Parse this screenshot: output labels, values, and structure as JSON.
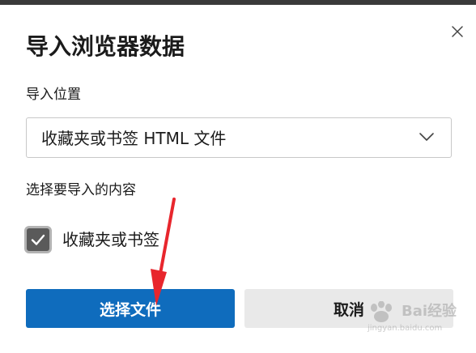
{
  "dialog": {
    "title": "导入浏览器数据",
    "close_icon": "close-icon",
    "location_label": "导入位置",
    "location_select": {
      "value": "收藏夹或书签 HTML 文件",
      "icon": "chevron-down-icon"
    },
    "content_label": "选择要导入的内容",
    "content_options": [
      {
        "label": "收藏夹或书签",
        "checked": true
      }
    ],
    "primary_button": "选择文件",
    "secondary_button": "取消",
    "accent_color": "#0f6cbd"
  },
  "annotation": {
    "arrow_color": "#e8262d"
  },
  "watermark": {
    "text": "Bai经验",
    "sub": "jingyan.baidu.com"
  }
}
